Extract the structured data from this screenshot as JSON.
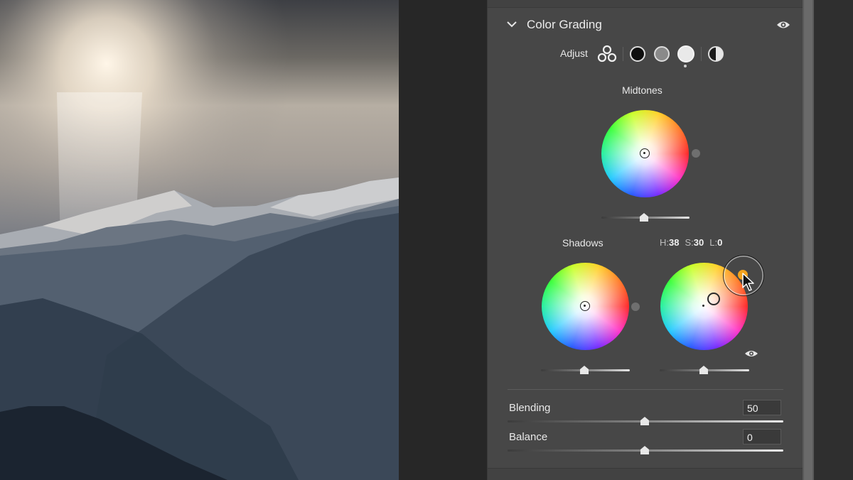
{
  "panel": {
    "title": "Color Grading",
    "adjust_label": "Adjust",
    "icons": {
      "collapse": "chevron-down-icon",
      "visibility": "eye-icon",
      "three_way": "three-way-icon",
      "shadows": "shadows-circle-icon",
      "midtones": "midtones-circle-icon",
      "highlights": "highlights-circle-icon",
      "global": "global-half-circle-icon"
    },
    "selected_adjust": "highlights"
  },
  "midtones": {
    "label": "Midtones"
  },
  "shadows": {
    "label": "Shadows"
  },
  "highlights": {
    "h_label": "H:",
    "h_value": "38",
    "s_label": "S:",
    "s_value": "30",
    "l_label": "L:",
    "l_value": "0",
    "cursor_color": "#f2a21d"
  },
  "blending": {
    "label": "Blending",
    "value": "50"
  },
  "balance": {
    "label": "Balance",
    "value": "0"
  }
}
